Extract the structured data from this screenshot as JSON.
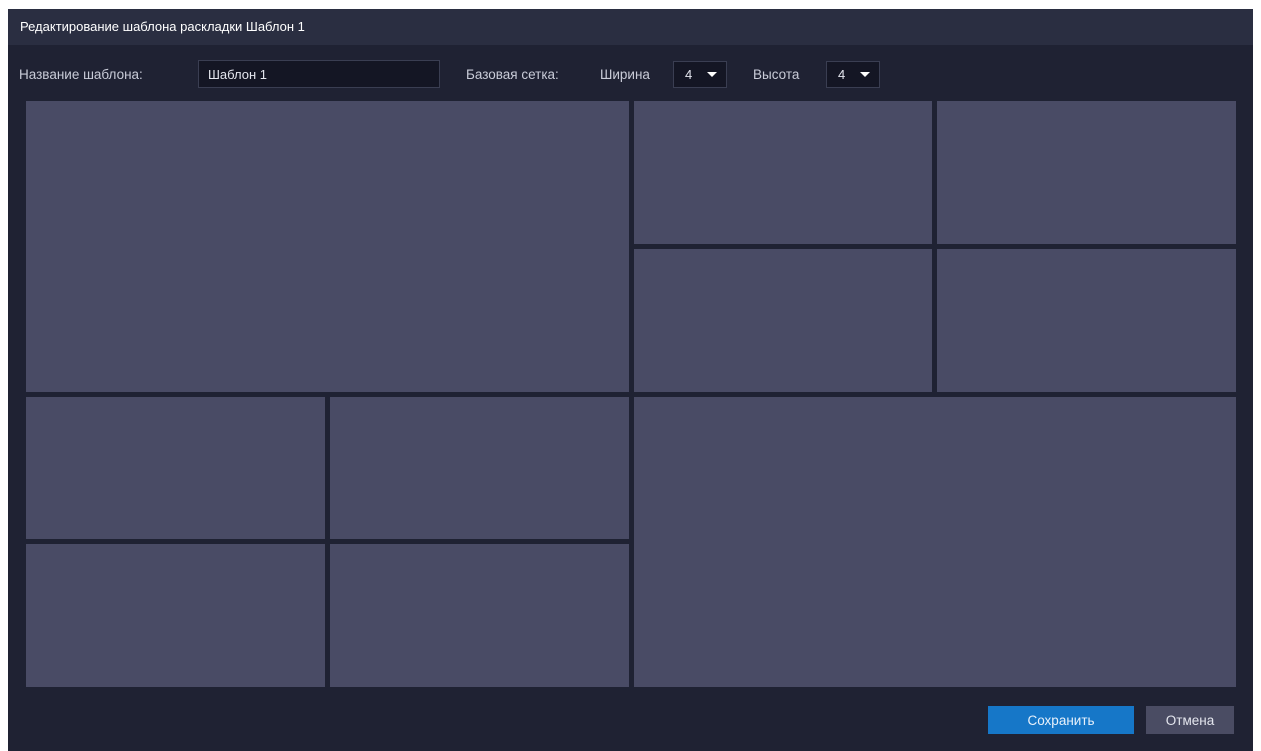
{
  "dialog": {
    "title": "Редактирование шаблона раскладки Шаблон 1"
  },
  "form": {
    "name_label": "Название шаблона:",
    "name_value": "Шаблон 1",
    "base_grid_label": "Базовая сетка:",
    "width_label": "Ширина",
    "width_value": "4",
    "height_label": "Высота",
    "height_value": "4"
  },
  "layout": {
    "columns": 4,
    "rows": 4,
    "cells": [
      {
        "id": "cell-1",
        "col": 1,
        "row": 1,
        "col_span": 2,
        "row_span": 2
      },
      {
        "id": "cell-2",
        "col": 3,
        "row": 1,
        "col_span": 1,
        "row_span": 1
      },
      {
        "id": "cell-3",
        "col": 4,
        "row": 1,
        "col_span": 1,
        "row_span": 1
      },
      {
        "id": "cell-4",
        "col": 3,
        "row": 2,
        "col_span": 1,
        "row_span": 1
      },
      {
        "id": "cell-5",
        "col": 4,
        "row": 2,
        "col_span": 1,
        "row_span": 1
      },
      {
        "id": "cell-6",
        "col": 1,
        "row": 3,
        "col_span": 1,
        "row_span": 1
      },
      {
        "id": "cell-7",
        "col": 2,
        "row": 3,
        "col_span": 1,
        "row_span": 1
      },
      {
        "id": "cell-8",
        "col": 1,
        "row": 4,
        "col_span": 1,
        "row_span": 1
      },
      {
        "id": "cell-9",
        "col": 2,
        "row": 4,
        "col_span": 1,
        "row_span": 1
      },
      {
        "id": "cell-10",
        "col": 3,
        "row": 3,
        "col_span": 2,
        "row_span": 2
      }
    ]
  },
  "footer": {
    "save_label": "Сохранить",
    "cancel_label": "Отмена"
  },
  "colors": {
    "dialog_background": "#1f2233",
    "titlebar_background": "#2a2e41",
    "cell_fill": "#494b65",
    "primary_button": "#1677c8",
    "secondary_button": "#4a4c63"
  }
}
